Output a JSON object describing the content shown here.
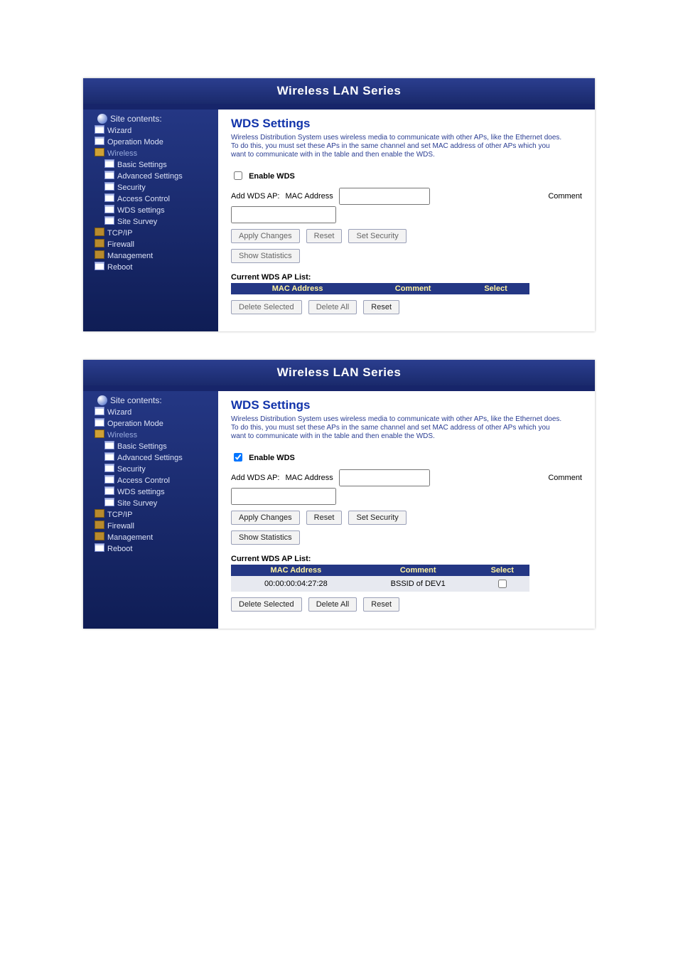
{
  "titlebar": "Wireless LAN Series",
  "sidebar": {
    "heading": "Site contents:",
    "items": {
      "wizard": "Wizard",
      "opmode": "Operation Mode",
      "wireless": "Wireless",
      "basic": "Basic Settings",
      "advanced": "Advanced Settings",
      "security": "Security",
      "access": "Access Control",
      "wds": "WDS settings",
      "survey": "Site Survey",
      "tcpip": "TCP/IP",
      "firewall": "Firewall",
      "mgmt": "Management",
      "reboot": "Reboot"
    }
  },
  "main": {
    "title": "WDS Settings",
    "desc": "Wireless Distribution System uses wireless media to communicate with other APs, like the Ethernet does. To do this, you must set these APs in the same channel and set MAC address of other APs which you want to communicate with in the table and then enable the WDS.",
    "enable_label": "Enable WDS",
    "addwds_label": "Add WDS AP:",
    "mac_label": "MAC Address",
    "comment_label": "Comment",
    "btn_apply": "Apply Changes",
    "btn_reset": "Reset",
    "btn_setsec": "Set Security",
    "btn_stats": "Show Statistics",
    "list_heading": "Current WDS AP List:",
    "th_mac": "MAC Address",
    "th_comment": "Comment",
    "th_select": "Select",
    "btn_delsel": "Delete Selected",
    "btn_delall": "Delete All",
    "btn_reset2": "Reset"
  },
  "panel2_row": {
    "mac": "00:00:00:04:27:28",
    "comment": "BSSID of DEV1"
  }
}
